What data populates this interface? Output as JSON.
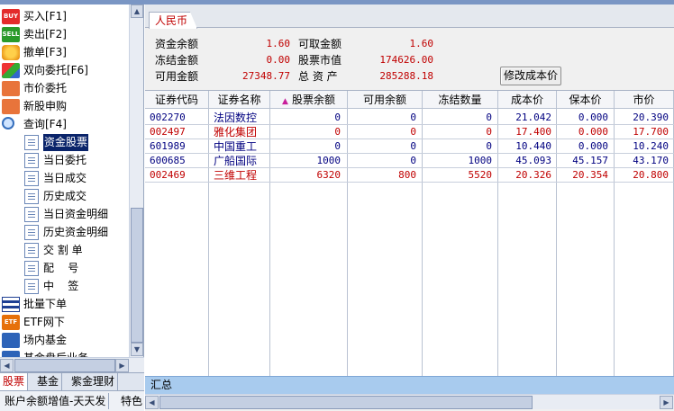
{
  "nav": {
    "items": [
      {
        "label": "买入[F1]",
        "icon": "buy-icon"
      },
      {
        "label": "卖出[F2]",
        "icon": "sell-icon"
      },
      {
        "label": "撤单[F3]",
        "icon": "cancel-order-icon"
      },
      {
        "label": "双向委托[F6]",
        "icon": "two-way-order-icon"
      },
      {
        "label": "市价委托",
        "icon": "market-order-icon"
      },
      {
        "label": "新股申购",
        "icon": "ipo-subscribe-icon"
      },
      {
        "label": "查询[F4]",
        "icon": "query-icon"
      },
      {
        "label": "资金股票",
        "icon": "document-icon",
        "selected": true
      },
      {
        "label": "当日委托",
        "icon": "document-icon"
      },
      {
        "label": "当日成交",
        "icon": "document-icon"
      },
      {
        "label": "历史成交",
        "icon": "document-icon"
      },
      {
        "label": "当日资金明细",
        "icon": "document-icon"
      },
      {
        "label": "历史资金明细",
        "icon": "document-icon"
      },
      {
        "label": "交 割 单",
        "icon": "document-icon"
      },
      {
        "label": "配    号",
        "icon": "document-icon"
      },
      {
        "label": "中    签",
        "icon": "document-icon"
      },
      {
        "label": "批量下单",
        "icon": "batch-order-icon"
      },
      {
        "label": "ETF网下",
        "icon": "etf-icon"
      },
      {
        "label": "场内基金",
        "icon": "fund-icon"
      },
      {
        "label": "基金盘后业务",
        "icon": "fund-icon"
      }
    ]
  },
  "bottom_tabs": [
    "股票",
    "基金",
    "紫金理财"
  ],
  "bottom_bar": [
    "账户余额增值-天天发",
    "特色"
  ],
  "main": {
    "tab": "人民币",
    "summary": {
      "labels": [
        "资金余额",
        "冻结金额",
        "可用金额",
        "可取金额",
        "股票市值",
        "总 资 产"
      ],
      "values": [
        "1.60",
        "0.00",
        "27348.77",
        "1.60",
        "174626.00",
        "285288.18"
      ]
    },
    "modify_cost_button": "修改成本价",
    "table": {
      "headers": [
        "证券代码",
        "证券名称",
        "股票余额",
        "可用余额",
        "冻结数量",
        "成本价",
        "保本价",
        "市价"
      ],
      "sort_column": 2,
      "sort_indicator": "▲",
      "rows": [
        {
          "code": "002270",
          "name": "法因数控",
          "balance": "0",
          "available": "0",
          "frozen": "0",
          "cost": "21.042",
          "breakeven": "0.000",
          "price": "20.390",
          "color": "#000080"
        },
        {
          "code": "002497",
          "name": "雅化集团",
          "balance": "0",
          "available": "0",
          "frozen": "0",
          "cost": "17.400",
          "breakeven": "0.000",
          "price": "17.700",
          "color": "#c00000"
        },
        {
          "code": "601989",
          "name": "中国重工",
          "balance": "0",
          "available": "0",
          "frozen": "0",
          "cost": "10.440",
          "breakeven": "0.000",
          "price": "10.240",
          "color": "#000080"
        },
        {
          "code": "600685",
          "name": "广船国际",
          "balance": "1000",
          "available": "0",
          "frozen": "1000",
          "cost": "45.093",
          "breakeven": "45.157",
          "price": "43.170",
          "color": "#000080"
        },
        {
          "code": "002469",
          "name": "三维工程",
          "balance": "6320",
          "available": "800",
          "frozen": "5520",
          "cost": "20.326",
          "breakeven": "20.354",
          "price": "20.800",
          "color": "#c00000"
        }
      ]
    },
    "total_label": "汇总"
  },
  "colors": {
    "selected_bg": "#0a246a",
    "accent_red": "#c00000",
    "row_blue": "#000080",
    "total_bar": "#a8cbee"
  }
}
